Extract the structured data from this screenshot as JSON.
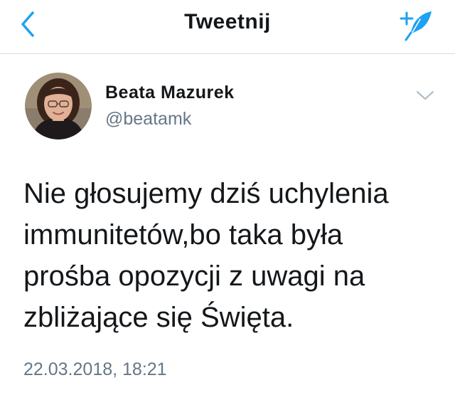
{
  "nav": {
    "title": "Tweetnij",
    "back_icon": "chevron-left-icon",
    "compose_icon": "compose-tweet-icon",
    "accent_color": "#1da1f2"
  },
  "tweet": {
    "author": {
      "name": "Beata Mazurek",
      "handle": "@beatamk",
      "avatar_icon": "user-avatar"
    },
    "menu_icon": "chevron-down-icon",
    "text_lines": [
      "Nie głosujemy dziś uchylenia",
      "immunitetów,bo taka była",
      "prośba opozycji z uwagi na",
      "zbliżające się Święta."
    ],
    "timestamp": "22.03.2018, 18:21"
  },
  "colors": {
    "text_primary": "#14171a",
    "text_secondary": "#657786",
    "divider": "#d8dde1"
  }
}
